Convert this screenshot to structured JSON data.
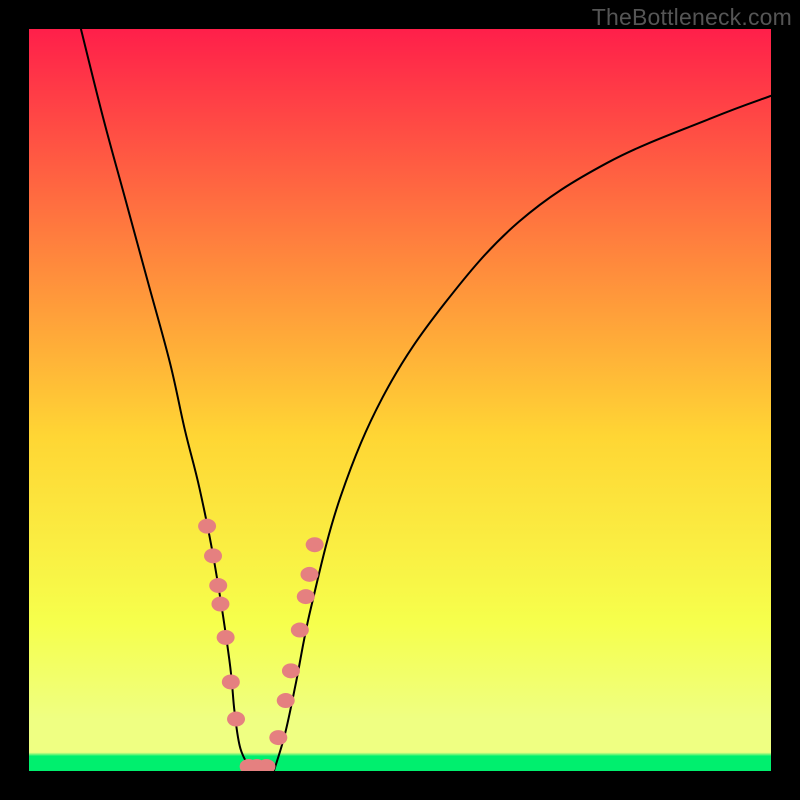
{
  "watermark": "TheBottleneck.com",
  "gradient": {
    "top": "#ff1f4a",
    "mid_upper": "#ff843d",
    "mid": "#ffd634",
    "mid_lower": "#f6ff4c",
    "low": "#efff82",
    "green": "#00ef6e"
  },
  "dot_color": "#e58080",
  "curve_color": "#000000",
  "chart_data": {
    "type": "line",
    "title": "",
    "xlabel": "",
    "ylabel": "",
    "xlim": [
      0,
      100
    ],
    "ylim": [
      0,
      100
    ],
    "series": [
      {
        "name": "left-curve",
        "x": [
          7,
          10,
          13,
          16,
          19,
          21,
          23,
          25,
          27,
          27.7,
          28.5,
          30
        ],
        "values": [
          100,
          88,
          77,
          66,
          55,
          46,
          38,
          28,
          15,
          8,
          3,
          0
        ]
      },
      {
        "name": "right-curve",
        "x": [
          33,
          34.5,
          36,
          38,
          42,
          48,
          56,
          66,
          78,
          92,
          100
        ],
        "values": [
          0,
          5,
          12,
          22,
          37,
          51,
          63,
          74,
          82,
          88,
          91
        ]
      }
    ],
    "markers": {
      "name": "datapoints",
      "color": "#e58080",
      "x": [
        24.0,
        24.8,
        25.5,
        25.8,
        26.5,
        27.2,
        27.9,
        29.6,
        30.7,
        32.0,
        33.6,
        34.6,
        35.3,
        36.5,
        37.3,
        37.8,
        38.5
      ],
      "y": [
        33.0,
        29.0,
        25.0,
        22.5,
        18.0,
        12.0,
        7.0,
        0.6,
        0.6,
        0.6,
        4.5,
        9.5,
        13.5,
        19.0,
        23.5,
        26.5,
        30.5
      ]
    }
  }
}
